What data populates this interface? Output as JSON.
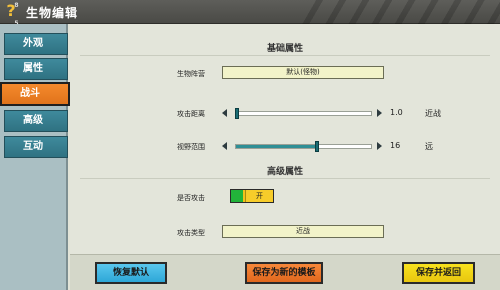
{
  "window": {
    "title": "生物编辑",
    "icon_glyph": "?",
    "icon_tiny": "8 5"
  },
  "sidebar": {
    "tabs": [
      {
        "label": "外观",
        "active": false
      },
      {
        "label": "属性",
        "active": false
      },
      {
        "label": "战斗",
        "active": true
      },
      {
        "label": "高级",
        "active": false
      },
      {
        "label": "互动",
        "active": false
      }
    ]
  },
  "basic": {
    "section_title": "基础属性",
    "faction": {
      "label": "生物阵营",
      "value": "默认(怪物)"
    },
    "attack_range": {
      "label": "攻击距离",
      "value": "1.0",
      "desc": "近战",
      "level": 0.0
    },
    "view_range": {
      "label": "视野范围",
      "value": "16",
      "desc": "远",
      "level": 0.6
    }
  },
  "advanced": {
    "section_title": "高级属性",
    "can_attack": {
      "label": "是否攻击",
      "toggle_label": "开"
    },
    "attack_type": {
      "label": "攻击类型",
      "value": "近战"
    }
  },
  "buttons": {
    "restore": "恢复默认",
    "save_template": "保存为新的模板",
    "save_return": "保存并返回"
  },
  "colors": {
    "tab": "#2f7282",
    "tab_active": "#f0801f",
    "slider_fill": "#2f8f95",
    "toggle_on": "#22b33a",
    "btn_blue": "#2ea7d7",
    "btn_orange": "#e0671d",
    "btn_yellow": "#e8c60f"
  }
}
